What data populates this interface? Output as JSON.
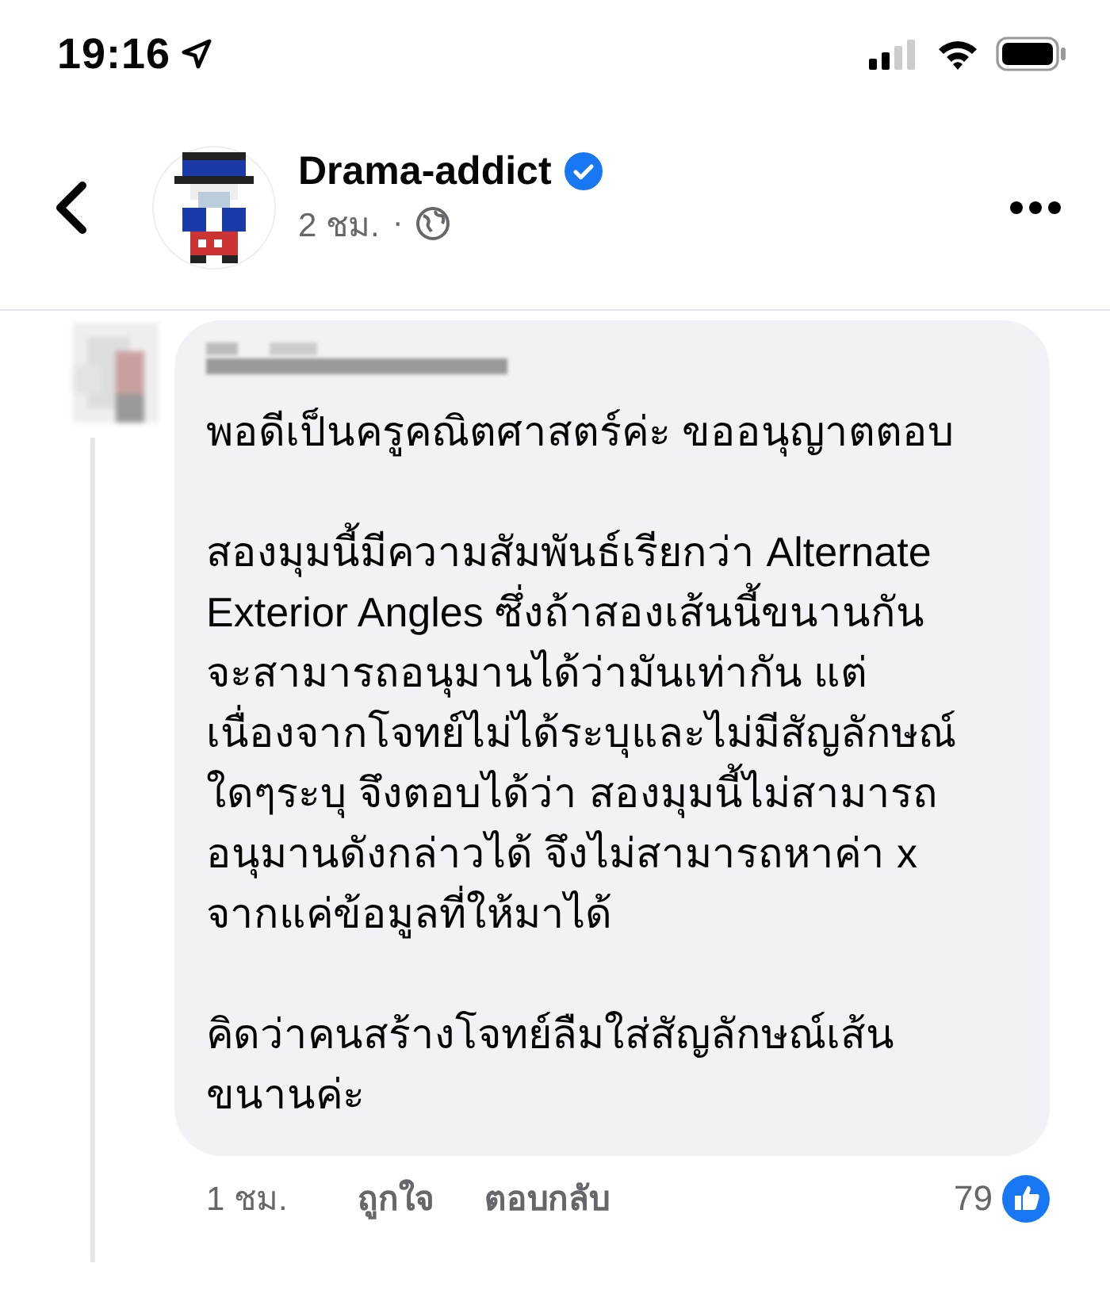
{
  "status_bar": {
    "time": "19:16"
  },
  "header": {
    "page_name": "Drama-addict",
    "verified": true,
    "time": "2 ชม.",
    "separator": "·"
  },
  "comment": {
    "paragraphs": [
      "พอดีเป็นครูคณิตศาสตร์ค่ะ ขออนุญาตตอบ",
      "สองมุมนี้มีความสัมพันธ์เรียกว่า Alternate\nExterior Angles ซึ่งถ้าสองเส้นนี้ขนานกัน\nจะสามารถอนุมานได้ว่ามันเท่ากัน แต่\nเนื่องจากโจทย์ไม่ได้ระบุและไม่มีสัญลักษณ์\nใดๆระบุ จึงตอบได้ว่า สองมุมนี้ไม่สามารถ\nอนุมานดังกล่าวได้ จึงไม่สามารถหาค่า x\nจากแค่ข้อมูลที่ให้มาได้",
      "คิดว่าคนสร้างโจทย์ลืมใส่สัญลักษณ์เส้น\nขนานค่ะ"
    ],
    "time": "1 ชม.",
    "actions": [
      "ถูกใจ",
      "ตอบกลับ"
    ],
    "reaction_count": "79"
  }
}
